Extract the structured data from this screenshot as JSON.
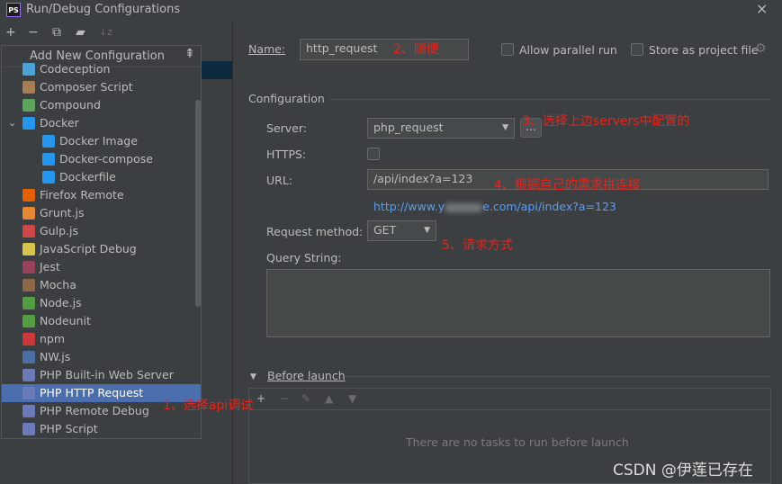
{
  "window": {
    "app_icon_text": "PS",
    "title": "Run/Debug Configurations",
    "close_glyph": "×"
  },
  "toolbar": {
    "add_icon": "+",
    "remove_icon": "−",
    "copy_icon": "⧉",
    "folder_icon": "▰",
    "sort_icon": "↓z"
  },
  "popup": {
    "header": "Add New Configuration",
    "collapse_glyph": "⇞",
    "items": [
      {
        "label": "Codeception",
        "icon": "codeception-icon",
        "color": "#4aa4d9",
        "indent": 0
      },
      {
        "label": "Composer Script",
        "icon": "composer-icon",
        "color": "#a67c52",
        "indent": 0
      },
      {
        "label": "Compound",
        "icon": "compound-icon",
        "color": "#5aa55a",
        "indent": 0
      },
      {
        "label": "Docker",
        "icon": "docker-icon",
        "color": "#2496ed",
        "indent": 0,
        "expand": "⌄"
      },
      {
        "label": "Docker Image",
        "icon": "docker-icon",
        "color": "#2496ed",
        "indent": 1
      },
      {
        "label": "Docker-compose",
        "icon": "docker-icon",
        "color": "#2496ed",
        "indent": 1
      },
      {
        "label": "Dockerfile",
        "icon": "docker-icon",
        "color": "#2496ed",
        "indent": 1
      },
      {
        "label": "Firefox Remote",
        "icon": "firefox-icon",
        "color": "#e66000",
        "indent": 0
      },
      {
        "label": "Grunt.js",
        "icon": "grunt-icon",
        "color": "#e48632",
        "indent": 0
      },
      {
        "label": "Gulp.js",
        "icon": "gulp-icon",
        "color": "#cf4647",
        "indent": 0
      },
      {
        "label": "JavaScript Debug",
        "icon": "js-debug-icon",
        "color": "#d6c34a",
        "indent": 0
      },
      {
        "label": "Jest",
        "icon": "jest-icon",
        "color": "#99425b",
        "indent": 0
      },
      {
        "label": "Mocha",
        "icon": "mocha-icon",
        "color": "#8d6748",
        "indent": 0
      },
      {
        "label": "Node.js",
        "icon": "nodejs-icon",
        "color": "#539e43",
        "indent": 0
      },
      {
        "label": "Nodeunit",
        "icon": "nodeunit-icon",
        "color": "#539e43",
        "indent": 0
      },
      {
        "label": "npm",
        "icon": "npm-icon",
        "color": "#cb3837",
        "indent": 0
      },
      {
        "label": "NW.js",
        "icon": "nwjs-icon",
        "color": "#4a6fa5",
        "indent": 0
      },
      {
        "label": "PHP Built-in Web Server",
        "icon": "php-icon",
        "color": "#6b7ab8",
        "indent": 0
      },
      {
        "label": "PHP HTTP Request",
        "icon": "php-icon",
        "color": "#6b7ab8",
        "indent": 0,
        "selected": true
      },
      {
        "label": "PHP Remote Debug",
        "icon": "php-icon",
        "color": "#6b7ab8",
        "indent": 0
      },
      {
        "label": "PHP Script",
        "icon": "php-icon",
        "color": "#6b7ab8",
        "indent": 0
      }
    ]
  },
  "form": {
    "name_label": "Name:",
    "name_value": "http_request",
    "allow_parallel_label": "Allow parallel run",
    "store_project_label": "Store as project file",
    "configuration_section": "Configuration",
    "server_label": "Server:",
    "server_value": "php_request",
    "server_dots": "...",
    "https_label": "HTTPS:",
    "url_label": "URL:",
    "url_value": "/api/index?a=123",
    "url_preview_prefix": "http://www.y",
    "url_preview_suffix": "e.com/api/index?a=123",
    "request_method_label": "Request method:",
    "request_method_value": "GET",
    "query_string_label": "Query String:",
    "before_launch_label": "Before launch",
    "before_launch_empty": "There are no tasks to run before launch"
  },
  "annotations": {
    "a1": "1、选择api调试",
    "a2": "2、随便",
    "a3": "3、选择上边servers中配置的",
    "a4": "4、根据自己的需求拼连接",
    "a5": "5、请求方式"
  },
  "watermark": "CSDN @伊莲已存在"
}
